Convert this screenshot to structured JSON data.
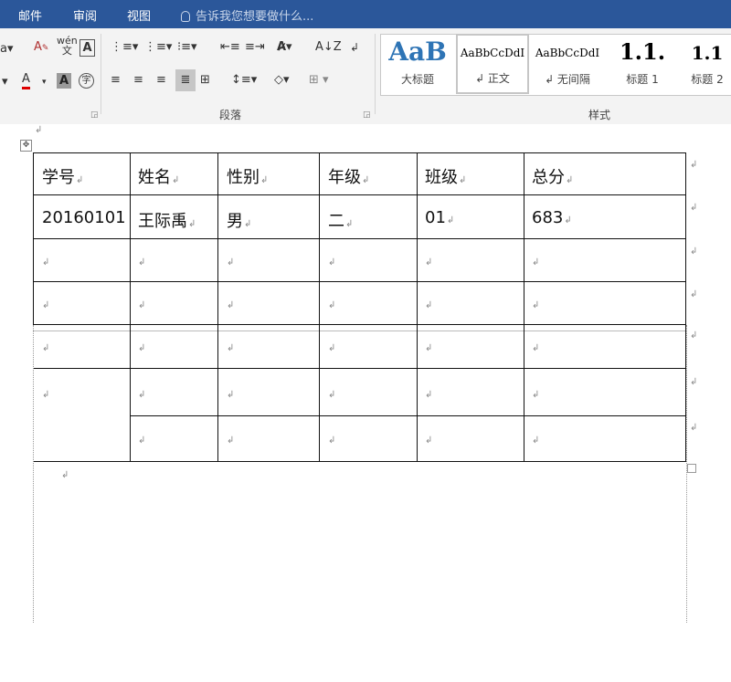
{
  "tabs": [
    "邮件",
    "审阅",
    "视图"
  ],
  "tell_me": "告诉我您想要做什么...",
  "ribbon": {
    "paragraph_label": "段落",
    "styles_label": "样式",
    "styles": [
      {
        "preview": "AaB",
        "label": "大标题"
      },
      {
        "preview": "AaBbCcDdI",
        "label": "↲ 正文"
      },
      {
        "preview": "AaBbCcDdI",
        "label": "↲ 无间隔"
      },
      {
        "preview": "1.1.",
        "label": "标题 1"
      },
      {
        "preview": "1.1",
        "label": "标题 2"
      }
    ]
  },
  "paragraph_mark": "↲",
  "table": {
    "headers": [
      "学号",
      "姓名",
      "性别",
      "年级",
      "班级",
      "总分"
    ],
    "row1": [
      "20160101",
      "王际禹",
      "男",
      "二",
      "01",
      "683"
    ]
  }
}
